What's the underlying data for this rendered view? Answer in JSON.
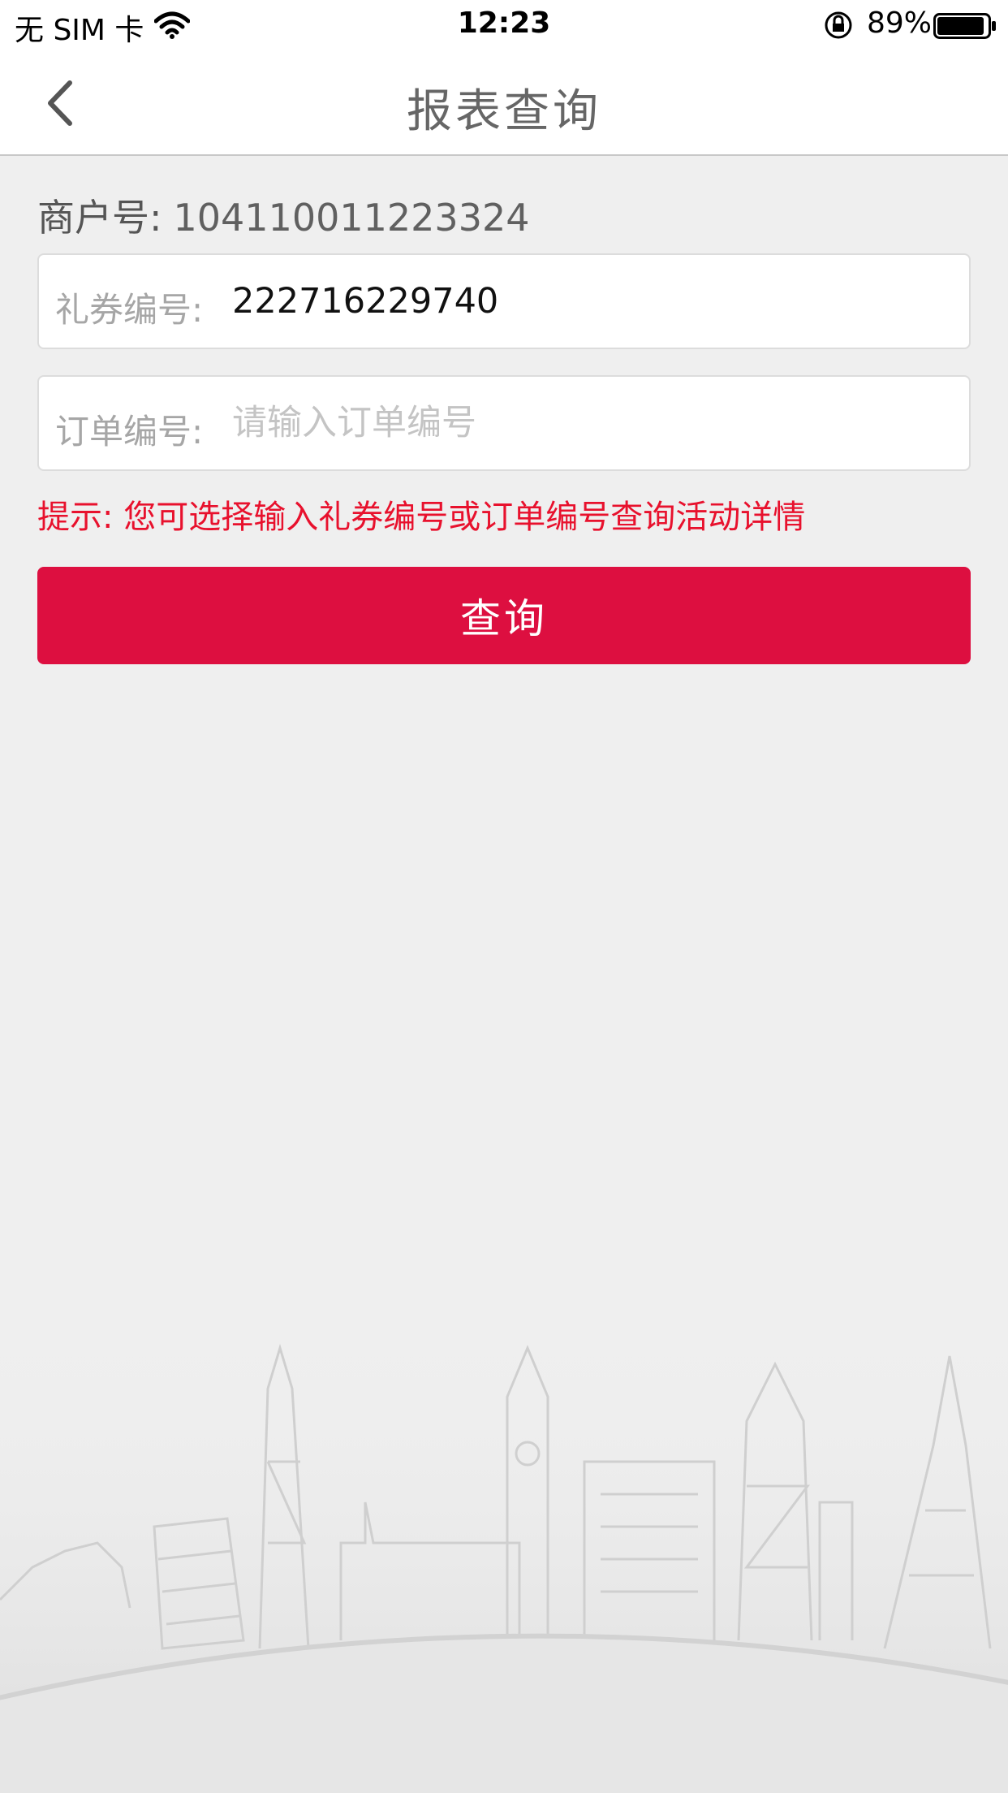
{
  "status_bar": {
    "carrier": "无 SIM 卡",
    "time": "12:23",
    "battery": "89%"
  },
  "nav": {
    "title": "报表查询",
    "back_icon": "chevron-left-icon"
  },
  "merchant": {
    "label": "商户号:",
    "value": "104110011223324"
  },
  "coupon_field": {
    "label": "礼券编号:",
    "value": "222716229740",
    "placeholder": ""
  },
  "order_field": {
    "label": "订单编号:",
    "value": "",
    "placeholder": "请输入订单编号"
  },
  "hint": "提示: 您可选择输入礼券编号或订单编号查询活动详情",
  "query_button": "查询",
  "colors": {
    "accent": "#dd0f40",
    "hint": "#e8112d",
    "background": "#efefef"
  }
}
